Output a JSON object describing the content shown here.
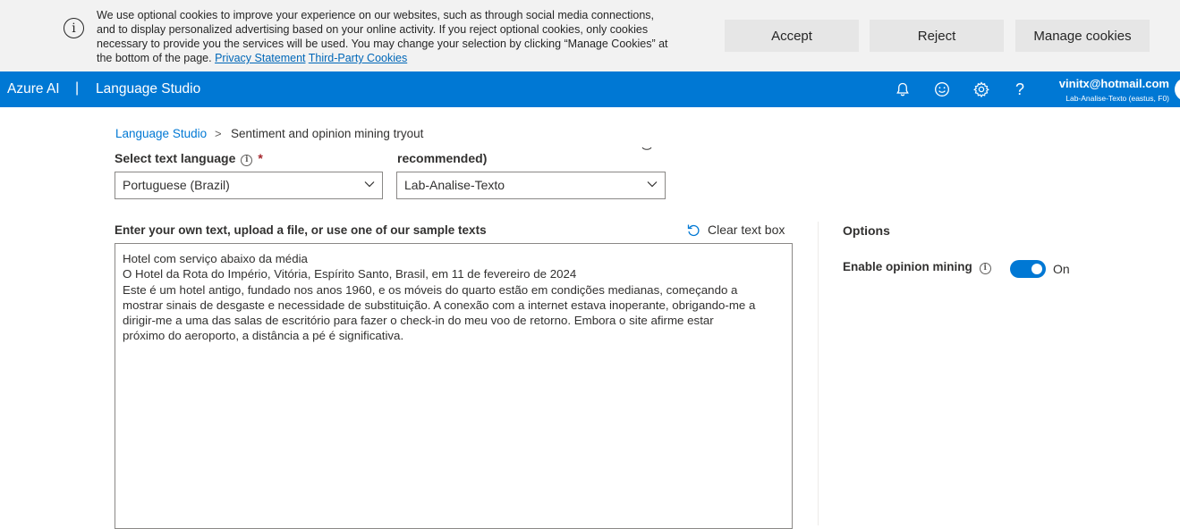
{
  "cookie_banner": {
    "message": "We use optional cookies to improve your experience on our websites, such as through social media connections, and to display personalized advertising based on your online activity. If you reject optional cookies, only cookies necessary to provide you the services will be used. You may change your selection by clicking “Manage Cookies” at the bottom of the page.",
    "privacy_link": "Privacy Statement",
    "third_party_link": "Third-Party Cookies",
    "accept_label": "Accept",
    "reject_label": "Reject",
    "manage_label": "Manage cookies"
  },
  "topbar": {
    "brand": "Azure AI",
    "separator": "|",
    "product": "Language Studio",
    "icons": [
      "bell-icon",
      "smiley-icon",
      "gear-icon",
      "help-icon"
    ],
    "help_glyph": "?",
    "user_email": "vinitx@hotmail.com",
    "user_resource": "Lab-Analise-Texto (eastus, F0)",
    "accent_color": "#0078d4"
  },
  "breadcrumb": {
    "root": "Language Studio",
    "separator": ">",
    "current": "Sentiment and opinion mining tryout"
  },
  "language_select": {
    "label": "Select text language",
    "required_mark": "*",
    "value": "Portuguese (Brazil)"
  },
  "resource_select": {
    "label": "recommended)",
    "value": "Lab-Analise-Texto"
  },
  "input": {
    "label": "Enter your own text, upload a file, or use one of our sample texts",
    "clear_label": "Clear text box",
    "text": "Hotel com serviço abaixo da média\nO Hotel da Rota do Império, Vitória, Espírito Santo, Brasil, em 11 de fevereiro de 2024\nEste é um hotel antigo, fundado nos anos 1960, e os móveis do quarto estão em condições medianas, começando a\nmostrar sinais de desgaste e necessidade de substituição. A conexão com a internet estava inoperante, obrigando-me a\ndirigir-me a uma das salas de escritório para fazer o check-in do meu voo de retorno. Embora o site afirme estar\npróximo do aeroporto, a distância a pé é significativa."
  },
  "options": {
    "title": "Options",
    "opinion_mining_label": "Enable opinion mining",
    "toggle_state": "On",
    "toggle_on": true
  }
}
